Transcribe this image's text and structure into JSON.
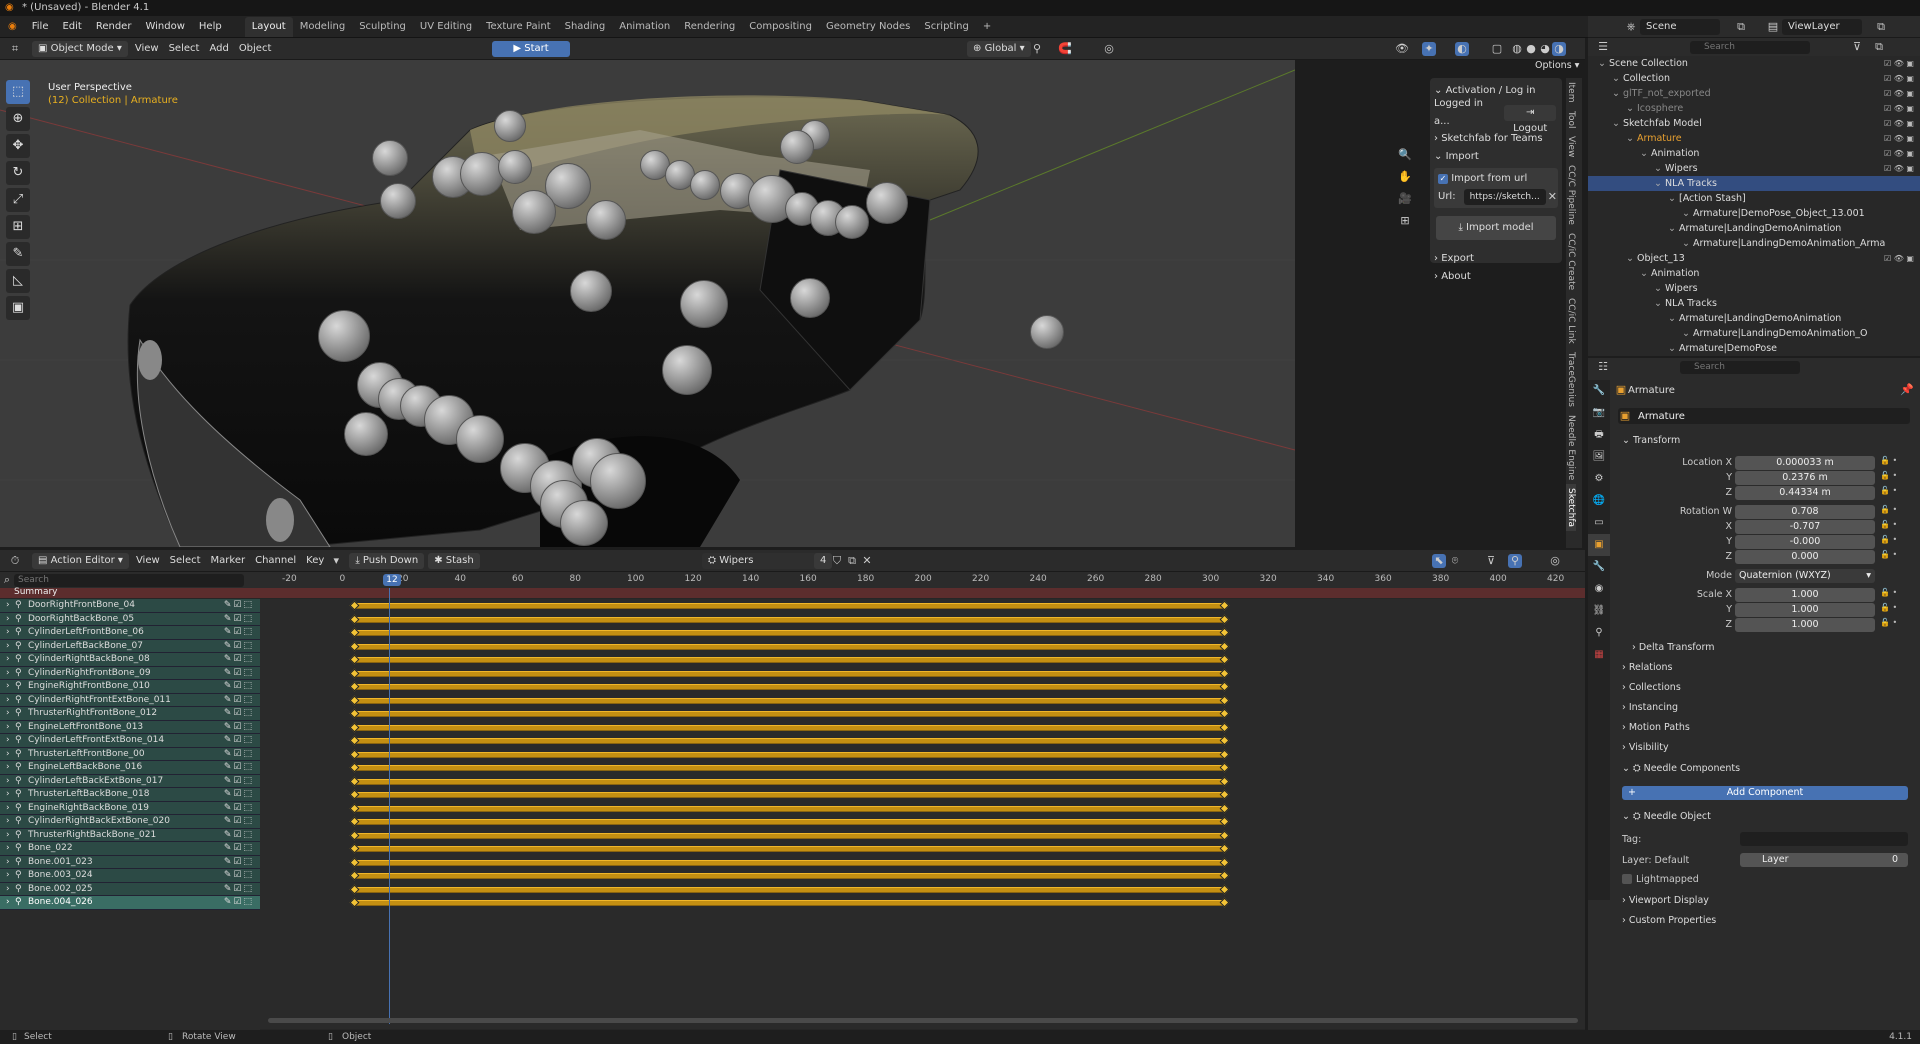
{
  "title": "* (Unsaved) - Blender 4.1",
  "menu": [
    "File",
    "Edit",
    "Render",
    "Window",
    "Help"
  ],
  "workspaces": [
    "Layout",
    "Modeling",
    "Sculpting",
    "UV Editing",
    "Texture Paint",
    "Shading",
    "Animation",
    "Rendering",
    "Compositing",
    "Geometry Nodes",
    "Scripting"
  ],
  "viewport": {
    "mode": "Object Mode",
    "menus": [
      "View",
      "Select",
      "Add",
      "Object"
    ],
    "transform": "Global",
    "start": "Start",
    "options": "Options",
    "persp": "User Perspective",
    "collection": "(12) Collection | Armature"
  },
  "npanel": {
    "activation": "Activation / Log in",
    "logged": "Logged in a...",
    "logout": "Logout",
    "teams": "Sketchfab for Teams",
    "import": "Import",
    "import_url": "Import from url",
    "url_label": "Url:",
    "url_value": "https://sketch...",
    "import_model": "Import model",
    "export": "Export",
    "about": "About"
  },
  "side_tabs": [
    "Item",
    "Tool",
    "View",
    "CC/C Pipeline",
    "CC/iC Create",
    "CC/iC Link",
    "TraceGenius",
    "Needle Engine",
    "Sketchfa"
  ],
  "dope": {
    "editor": "Action Editor",
    "menus": [
      "View",
      "Select",
      "Marker",
      "Channel",
      "Key"
    ],
    "push_down": "Push Down",
    "stash": "Stash",
    "action": "Wipers",
    "users": "4",
    "search_ph": "Search",
    "summary": "Summary",
    "current_frame": "12",
    "ticks": [
      "-20",
      "0",
      "20",
      "40",
      "60",
      "80",
      "100",
      "120",
      "140",
      "160",
      "180",
      "200",
      "220",
      "240",
      "260",
      "280",
      "300",
      "320",
      "340",
      "360",
      "380",
      "400",
      "420"
    ],
    "channels": [
      "DoorRightFrontBone_04",
      "DoorRightBackBone_05",
      "CylinderLeftFrontBone_06",
      "CylinderLeftBackBone_07",
      "CylinderRightBackBone_08",
      "CylinderRightFrontBone_09",
      "EngineRightFrontBone_010",
      "CylinderRightFrontExtBone_011",
      "ThrusterRightFrontBone_012",
      "EngineLeftFrontBone_013",
      "CylinderLeftFrontExtBone_014",
      "ThrusterLeftFrontBone_00",
      "EngineLeftBackBone_016",
      "CylinderLeftBackExtBone_017",
      "ThrusterLeftBackBone_018",
      "EngineRightBackBone_019",
      "CylinderRightBackExtBone_020",
      "ThrusterRightBackBone_021",
      "Bone_022",
      "Bone.001_023",
      "Bone.003_024",
      "Bone.002_025",
      "Bone.004_026"
    ]
  },
  "outliner": {
    "scene": "Scene",
    "viewlayer": "ViewLayer",
    "search_ph": "Search",
    "items": [
      {
        "t": "Scene Collection",
        "d": 0
      },
      {
        "t": "Collection",
        "d": 1
      },
      {
        "t": "glTF_not_exported",
        "d": 1,
        "dim": true
      },
      {
        "t": "Icosphere",
        "d": 2,
        "dim": true
      },
      {
        "t": "Sketchfab Model",
        "d": 1
      },
      {
        "t": "Armature",
        "d": 2,
        "hl": true
      },
      {
        "t": "Animation",
        "d": 3
      },
      {
        "t": "Wipers",
        "d": 4
      },
      {
        "t": "NLA Tracks",
        "d": 4,
        "sel": true
      },
      {
        "t": "[Action Stash]",
        "d": 5
      },
      {
        "t": "Armature|DemoPose_Object_13.001",
        "d": 6
      },
      {
        "t": "Armature|LandingDemoAnimation",
        "d": 5
      },
      {
        "t": "Armature|LandingDemoAnimation_Arma",
        "d": 6
      },
      {
        "t": "Object_13",
        "d": 2
      },
      {
        "t": "Animation",
        "d": 3
      },
      {
        "t": "Wipers",
        "d": 4
      },
      {
        "t": "NLA Tracks",
        "d": 4
      },
      {
        "t": "Armature|LandingDemoAnimation",
        "d": 5
      },
      {
        "t": "Armature|LandingDemoAnimation_O",
        "d": 6
      },
      {
        "t": "Armature|DemoPose",
        "d": 5
      }
    ]
  },
  "properties": {
    "search_ph": "Search",
    "object": "Armature",
    "object_name": "Armature",
    "transform": "Transform",
    "location_label": "Location X",
    "loc": [
      "0.000033 m",
      "0.2376 m",
      "0.44334 m"
    ],
    "rotation_label": "Rotation W",
    "rot": [
      "0.708",
      "-0.707",
      "-0.000",
      "0.000"
    ],
    "mode_label": "Mode",
    "mode": "Quaternion (WXYZ)",
    "scale_label": "Scale X",
    "scale": [
      "1.000",
      "1.000",
      "1.000"
    ],
    "y": "Y",
    "z": "Z",
    "x": "X",
    "delta": "Delta Transform",
    "relations": "Relations",
    "collections": "Collections",
    "instancing": "Instancing",
    "motion_paths": "Motion Paths",
    "visibility": "Visibility",
    "needle_components": "Needle Components",
    "add_component": "Add Component",
    "needle_object": "Needle Object",
    "tag": "Tag:",
    "layer_label": "Layer: Default",
    "layer": "Layer",
    "layer_val": "0",
    "lightmapped": "Lightmapped",
    "viewport_display": "Viewport Display",
    "custom_props": "Custom Properties"
  },
  "status": {
    "select": "Select",
    "rotate": "Rotate View",
    "object": "Object",
    "version": "4.1.1"
  }
}
